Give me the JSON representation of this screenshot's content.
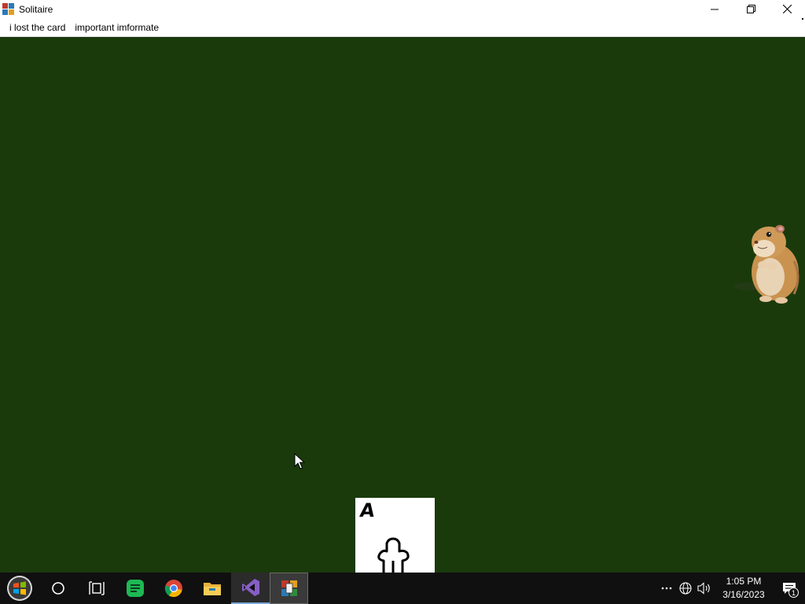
{
  "window": {
    "title": "Solitaire",
    "controls": {
      "minimize_icon": "minimize-icon",
      "maximize_icon": "restore-icon",
      "close_icon": "close-icon"
    }
  },
  "menu": {
    "items": [
      {
        "label": "i lost the card"
      },
      {
        "label": "important imformate"
      }
    ]
  },
  "game": {
    "background_color": "#1a3a0c",
    "card": {
      "rank": "A"
    },
    "decoration": "hamster-image"
  },
  "taskbar": {
    "apps": [
      {
        "icon": "start-icon"
      },
      {
        "icon": "search-circle-icon"
      },
      {
        "icon": "task-view-icon"
      },
      {
        "icon": "notes-app-icon"
      },
      {
        "icon": "chrome-icon"
      },
      {
        "icon": "file-explorer-icon"
      },
      {
        "icon": "visual-studio-icon"
      },
      {
        "icon": "solitaire-app-icon"
      }
    ],
    "tray": {
      "time": "1:05 PM",
      "date": "3/16/2023",
      "notification_count": "1"
    }
  }
}
